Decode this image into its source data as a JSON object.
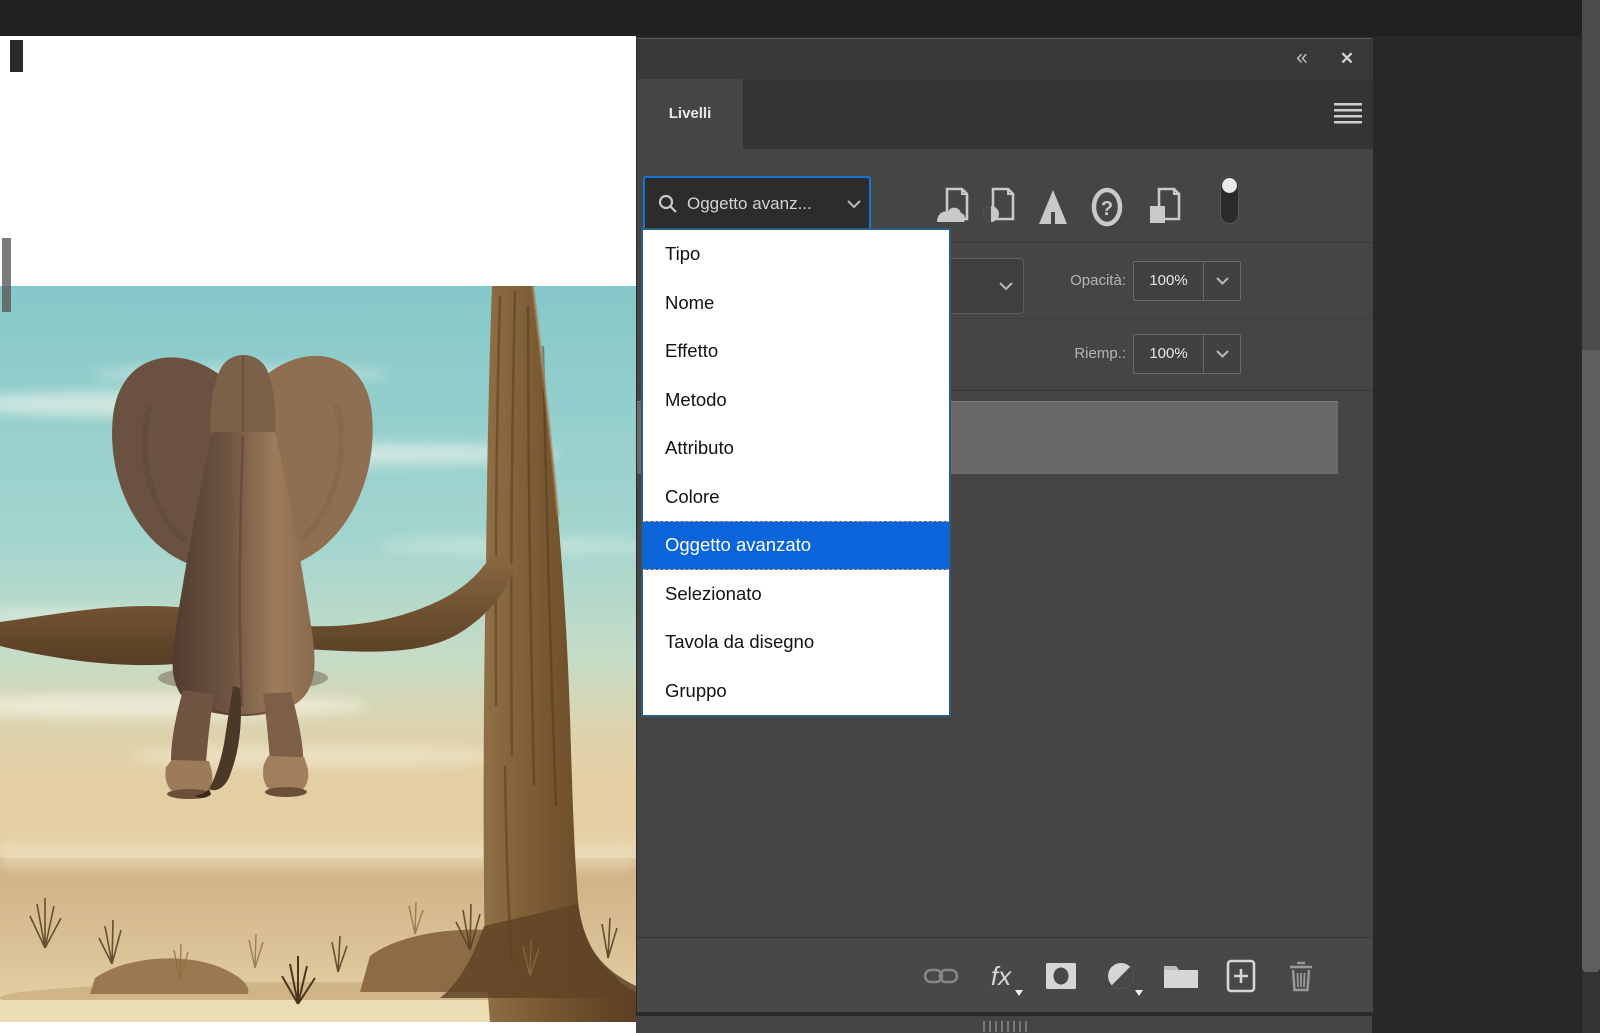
{
  "panel": {
    "tab_label": "Livelli",
    "collapse_icon": "«",
    "close_icon": "✕",
    "menu_icon": "panel-menu",
    "filter": {
      "search_value": "Oggetto avanz...",
      "icons": [
        "pixel-layer-filter",
        "adjustment-layer-filter",
        "type-layer-filter",
        "shape-layer-filter",
        "smart-object-filter"
      ],
      "toggle_state": "on"
    },
    "opacity_label": "Opacità:",
    "opacity_value": "100%",
    "fill_label": "Riemp.:",
    "fill_value": "100%",
    "fx_label": "fx",
    "toolbar": [
      "link-layers",
      "layer-styles",
      "add-layer-mask",
      "new-adjustment-layer",
      "new-group",
      "new-layer",
      "delete-layer"
    ]
  },
  "dropdown": {
    "items": [
      "Tipo",
      "Nome",
      "Effetto",
      "Metodo",
      "Attributo",
      "Colore",
      "Oggetto avanzato",
      "Selezionato",
      "Tavola da disegno",
      "Gruppo"
    ],
    "selected_index": 6,
    "selected_item": "Oggetto avanzato"
  },
  "canvas": {
    "image_subject": "elephant sitting on bare tree branch above desert sand"
  },
  "colors": {
    "selection_blue": "#0b64da",
    "focus_border_blue": "#1876d2",
    "dropdown_border": "#2a5f80",
    "panel_bg": "#454545",
    "panel_header_bg": "#393939",
    "selected_row_gray": "#696969",
    "workspace_bg": "#282828",
    "sky_teal": "#8ac9c9",
    "sand": "#d9c094"
  }
}
